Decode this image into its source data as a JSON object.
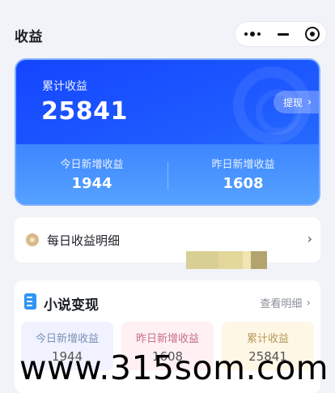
{
  "nav": {
    "title": "收益",
    "capsule": {
      "more_icon": "more-dots-icon",
      "minimize_icon": "minimize-icon",
      "close_icon": "target-close-icon"
    }
  },
  "earnings": {
    "total_label": "累计收益",
    "total_value": "25841",
    "withdraw_label": "提现",
    "today_label": "今日新增收益",
    "today_value": "1944",
    "yesterday_label": "昨日新增收益",
    "yesterday_value": "1608",
    "gradient_start": "#1445ff",
    "gradient_end": "#56a3ff"
  },
  "daily_detail": {
    "label": "每日收益明细",
    "icon": "coin-icon"
  },
  "novel": {
    "title": "小说变现",
    "icon": "document-icon",
    "view_detail": "查看明细",
    "stats": [
      {
        "label": "今日新增收益",
        "value": "1944"
      },
      {
        "label": "昨日新增收益",
        "value": "1608"
      },
      {
        "label": "累计收益",
        "value": "25841"
      }
    ]
  },
  "watermark": {
    "text": "www.315som.com"
  }
}
